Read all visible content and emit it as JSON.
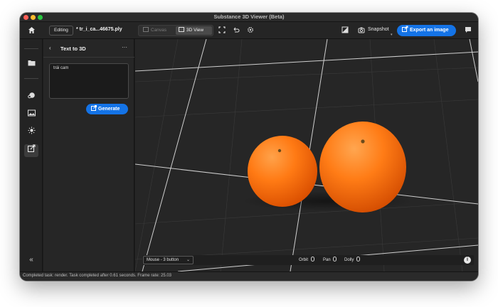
{
  "window": {
    "title": "Substance 3D Viewer (Beta)"
  },
  "toolbar": {
    "editing_label": "Editing",
    "filename": "* tr_i_ca...46675.ply",
    "canvas_label": "Canvas",
    "view3d_label": "3D View",
    "snapshot_label": "Snapshot",
    "export_label": "Export an image"
  },
  "panel": {
    "title": "Text to 3D",
    "prompt_text": "trái cam",
    "generate_label": "Generate"
  },
  "viewport_bar": {
    "mouse_mode": "Mouse - 3 button",
    "orbit_label": "Orbit",
    "pan_label": "Pan",
    "dolly_label": "Dolly"
  },
  "status": {
    "text": "Completed task: render. Task completed after 0.61 seconds. Frame rate: 25.03"
  },
  "colors": {
    "accent": "#1473e6",
    "orange_fruit": "#ff7a1a",
    "viewport_bg": "#262626",
    "grid_line": "#c8c8c8"
  },
  "icons": {
    "home": "home-icon",
    "frame": "frame-icon",
    "undo": "undo-icon",
    "settings": "settings-icon",
    "background": "background-icon",
    "snapshot": "camera-icon",
    "export": "export-icon",
    "feedback": "feedback-icon",
    "folder": "folder-icon",
    "materials": "materials-icon",
    "environment": "environment-icon",
    "light": "light-icon",
    "text_to_3d": "text-to-3d-icon",
    "collapse": "collapse-icon",
    "info": "info-icon"
  }
}
